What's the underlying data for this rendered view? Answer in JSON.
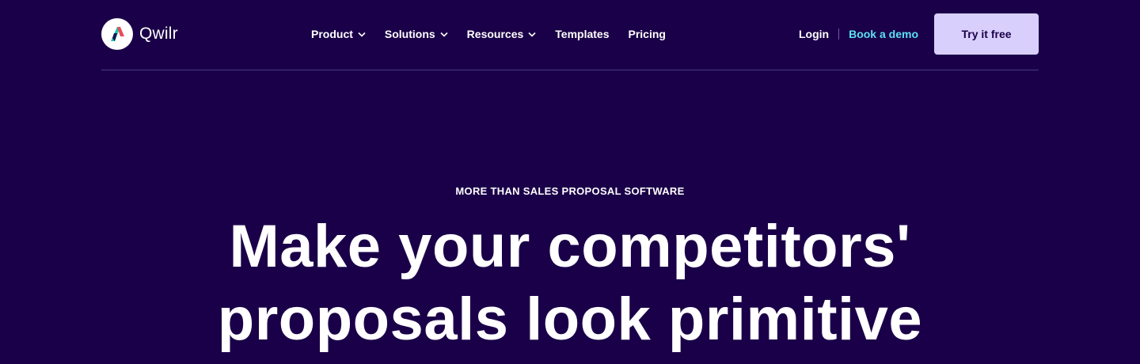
{
  "brand": {
    "name": "Qwilr",
    "logo_colors": [
      "#e94b5c",
      "#20c3a8",
      "#1a0048"
    ]
  },
  "nav": {
    "items": [
      {
        "label": "Product",
        "has_dropdown": true,
        "icon": "chevron-down-icon"
      },
      {
        "label": "Solutions",
        "has_dropdown": true,
        "icon": "chevron-down-icon"
      },
      {
        "label": "Resources",
        "has_dropdown": true,
        "icon": "chevron-down-icon"
      },
      {
        "label": "Templates",
        "has_dropdown": false
      },
      {
        "label": "Pricing",
        "has_dropdown": false
      }
    ]
  },
  "actions": {
    "login_label": "Login",
    "demo_label": "Book a demo",
    "try_label": "Try it free"
  },
  "hero": {
    "eyebrow": "MORE THAN SALES PROPOSAL SOFTWARE",
    "headline_line1": "Make your competitors'",
    "headline_line2": "proposals look primitive"
  },
  "colors": {
    "background": "#1a0048",
    "accent_link": "#5be0f2",
    "button_bg": "#d9cffd",
    "button_text": "#1a0048"
  }
}
